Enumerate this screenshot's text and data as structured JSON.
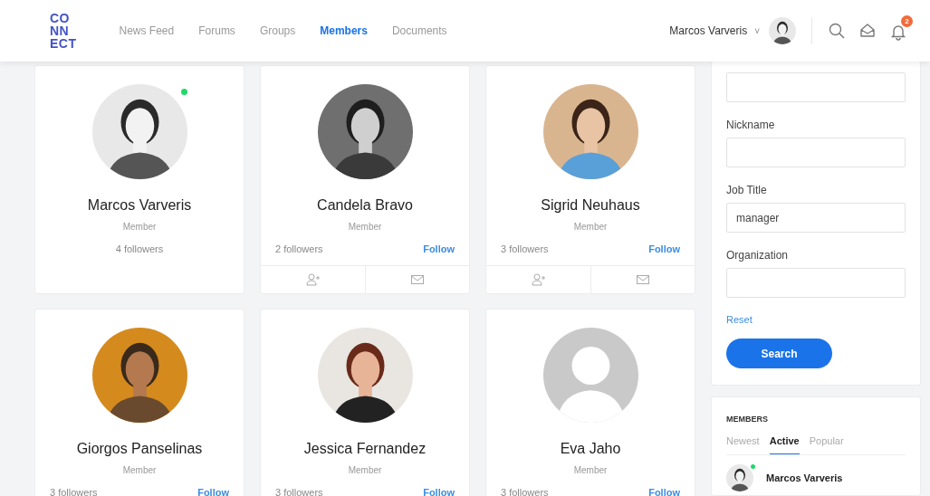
{
  "header": {
    "logo_lines": [
      "CO",
      "NN",
      "ECT"
    ],
    "nav": [
      {
        "label": "News Feed",
        "selected": false
      },
      {
        "label": "Forums",
        "selected": false
      },
      {
        "label": "Groups",
        "selected": false
      },
      {
        "label": "Members",
        "selected": true
      },
      {
        "label": "Documents",
        "selected": false
      }
    ],
    "user": {
      "name": "Marcos Varveris",
      "caret": "˅"
    },
    "notifications": "2"
  },
  "members": [
    {
      "kind": "self",
      "name": "Marcos Varveris",
      "role": "Member",
      "followers": "4 followers",
      "online": true
    },
    {
      "kind": "other",
      "name": "Candela Bravo",
      "role": "Member",
      "followers": "2 followers",
      "follow": "Follow",
      "online": false
    },
    {
      "kind": "other",
      "name": "Sigrid Neuhaus",
      "role": "Member",
      "followers": "3 followers",
      "follow": "Follow",
      "online": false
    },
    {
      "kind": "other",
      "name": "Giorgos Panselinas",
      "role": "Member",
      "followers": "3 followers",
      "follow": "Follow",
      "online": false
    },
    {
      "kind": "other",
      "name": "Jessica Fernandez",
      "role": "Member",
      "followers": "3 followers",
      "follow": "Follow",
      "online": false
    },
    {
      "kind": "other",
      "name": "Eva Jaho",
      "role": "Member",
      "followers": "3 followers",
      "follow": "Follow",
      "online": false,
      "avatar": {
        "kind": "default"
      }
    }
  ],
  "filter": {
    "fields": [
      {
        "kind": "text"
      },
      {
        "kind": "text",
        "label": "Nickname"
      },
      {
        "kind": "text",
        "label": "Job Title",
        "value": "manager"
      },
      {
        "kind": "text",
        "label": "Organization"
      }
    ],
    "reset": "Reset",
    "search": "Search"
  },
  "members_widget": {
    "title": "MEMBERS",
    "tabs": [
      {
        "label": "Newest",
        "selected": false
      },
      {
        "label": "Active",
        "selected": true
      },
      {
        "label": "Popular",
        "selected": false
      }
    ],
    "items": [
      {
        "name": "Marcos Varveris",
        "online": true
      }
    ]
  }
}
